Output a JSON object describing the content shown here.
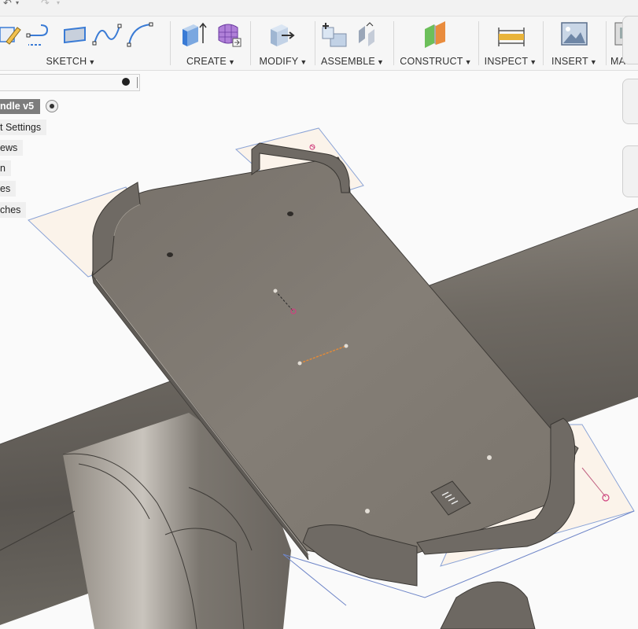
{
  "toolbar": {
    "groups": [
      {
        "label": "SKETCH"
      },
      {
        "label": "CREATE"
      },
      {
        "label": "MODIFY"
      },
      {
        "label": "ASSEMBLE"
      },
      {
        "label": "CONSTRUCT"
      },
      {
        "label": "INSPECT"
      },
      {
        "label": "INSERT"
      },
      {
        "label": "MA"
      }
    ]
  },
  "browser": {
    "root_label": "ndle v5",
    "items": [
      {
        "label": "t Settings"
      },
      {
        "label": "ews"
      },
      {
        "label": "n"
      },
      {
        "label": "es"
      },
      {
        "label": "ches"
      }
    ]
  },
  "colors": {
    "accent_blue": "#3a7bd5",
    "body_gray": "#7b766d",
    "sketch_orange": "#e08a3a",
    "sketch_magenta": "#d0417f"
  },
  "icons": [
    "sketch-rect-icon",
    "line-icon",
    "rectangle-icon",
    "spline-icon",
    "arc-icon",
    "box-icon",
    "form-icon",
    "press-pull-icon",
    "joint-icon",
    "align-icon",
    "plane-icon",
    "measure-icon",
    "canvas-icon"
  ]
}
